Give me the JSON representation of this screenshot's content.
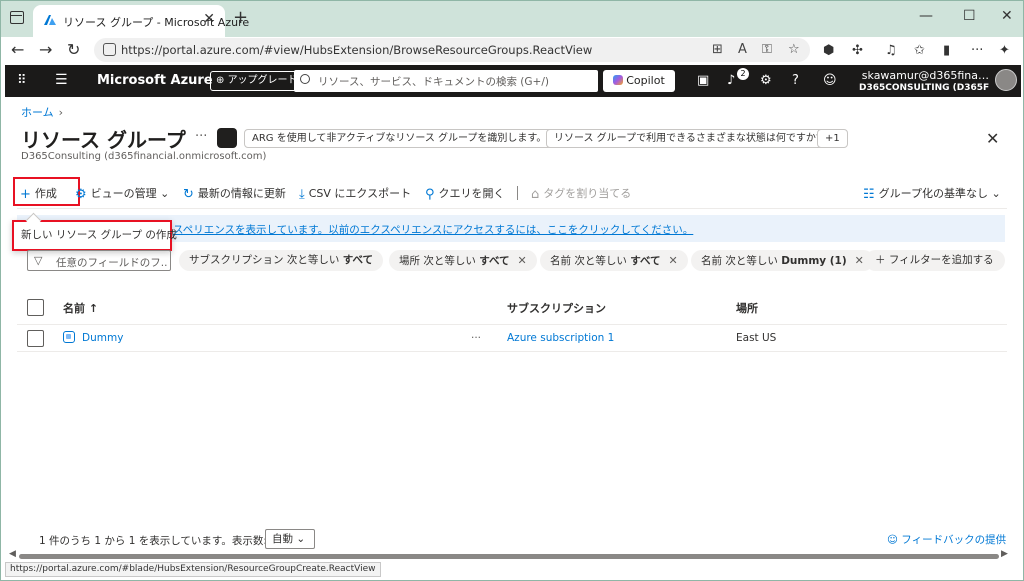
{
  "browser": {
    "tab_title": "リソース グループ - Microsoft Azure",
    "url": "https://portal.azure.com/#view/HubsExtension/BrowseResourceGroups.ReactView",
    "status_url": "https://portal.azure.com/#blade/HubsExtension/ResourceGroupCreate.ReactView"
  },
  "azure_header": {
    "brand": "Microsoft Azure",
    "upgrade_label": "アップグレード",
    "search_placeholder": "リソース、サービス、ドキュメントの検索 (G+/)",
    "copilot_label": "Copilot",
    "notification_count": "2",
    "account_user": "skawamur@d365fina…",
    "account_tenant": "D365CONSULTING (D365FI…"
  },
  "page": {
    "breadcrumb_home": "ホーム",
    "title": "リソース グループ",
    "subtitle": "D365Consulting (d365financial.onmicrosoft.com)",
    "suggestions": [
      "ARG を使用して非アクティブなリソース グループを識別します。",
      "リソース グループで利用できるさまざまな状態は何ですか?",
      "+1"
    ]
  },
  "toolbar": {
    "create": "作成",
    "manage_view": "ビューの管理",
    "refresh": "最新の情報に更新",
    "export_csv": "CSV にエクスポート",
    "open_query": "クエリを開く",
    "assign_tags": "タグを割り当てる",
    "group_by": "グループ化の基準なし"
  },
  "banner": {
    "text": "スペリエンスを表示しています。以前のエクスペリエンスにアクセスするには、ここをクリックしてください。"
  },
  "tooltip": {
    "text": "新しい リソース グループ の作成"
  },
  "filters": {
    "placeholder": "任意のフィールドのフ...",
    "chips": [
      {
        "field": "サブスクリプション",
        "op": "次と等しい",
        "value": "すべて"
      },
      {
        "field": "場所",
        "op": "次と等しい",
        "value": "すべて"
      },
      {
        "field": "名前",
        "op": "次と等しい",
        "value": "すべて"
      },
      {
        "field": "名前",
        "op": "次と等しい",
        "value": "Dummy (1)"
      }
    ],
    "add_filter": "フィルターを追加する"
  },
  "table": {
    "columns": [
      "名前 ↑",
      "サブスクリプション",
      "場所"
    ],
    "rows": [
      {
        "name": "Dummy",
        "subscription": "Azure subscription 1",
        "location": "East US"
      }
    ]
  },
  "footer": {
    "page_info": "1 件のうち 1 から 1 を表示しています。表示数:",
    "page_size": "自動",
    "feedback": "フィードバックの提供"
  },
  "colors": {
    "accent": "#0078d4",
    "highlight_box": "#e81123",
    "header_bg": "#1b1a19"
  }
}
